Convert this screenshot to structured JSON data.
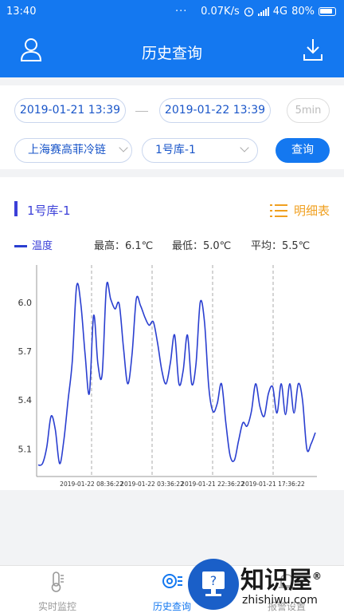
{
  "status_bar": {
    "time": "13:40",
    "dots": "···",
    "net_speed": "0.07K/s",
    "network": "4G",
    "battery": "80%"
  },
  "header": {
    "title": "历史查询"
  },
  "filters": {
    "start_datetime": "2019-01-21 13:39",
    "end_datetime": "2019-01-22 13:39",
    "interval": "5min",
    "company": "上海赛高菲冷链",
    "store": "1号库-1",
    "query_label": "查询"
  },
  "chart_panel": {
    "store_name": "1号库-1",
    "detail_label": "明细表",
    "legend_label": "温度",
    "max_label": "最高：6.1℃",
    "min_label": "最低：5.0℃",
    "avg_label": "平均：5.5℃"
  },
  "chart_data": {
    "type": "line",
    "title": "",
    "xlabel": "",
    "ylabel": "",
    "ylim": [
      4.93,
      6.23
    ],
    "yticks": [
      5.1,
      5.4,
      5.7,
      6.0
    ],
    "ytick_labels": [
      "5.1",
      "5.4",
      "5.7",
      "6.0"
    ],
    "xtick_labels": [
      "2019-01-22 08:36:22",
      "2019-01-22 03:36:22",
      "2019-01-21 22:36:22",
      "2019-01-21 17:36:22"
    ],
    "x_direction": "reversed (newest on the left)",
    "vertical_dashed_lines_at_ticks": true,
    "series": [
      {
        "name": "温度",
        "color": "#2a3fd0",
        "values": [
          5.0,
          5.01,
          5.11,
          5.3,
          5.22,
          5.01,
          5.15,
          5.4,
          5.64,
          6.1,
          5.99,
          5.68,
          5.44,
          5.92,
          5.62,
          5.56,
          6.1,
          6.02,
          5.96,
          5.99,
          5.72,
          5.5,
          5.68,
          6.02,
          5.98,
          5.91,
          5.86,
          5.88,
          5.75,
          5.58,
          5.5,
          5.63,
          5.8,
          5.5,
          5.58,
          5.8,
          5.5,
          5.62,
          6.0,
          5.88,
          5.48,
          5.33,
          5.38,
          5.5,
          5.26,
          5.06,
          5.03,
          5.15,
          5.26,
          5.24,
          5.33,
          5.5,
          5.36,
          5.3,
          5.44,
          5.48,
          5.32,
          5.5,
          5.31,
          5.5,
          5.32,
          5.5,
          5.4,
          5.1,
          5.13,
          5.2
        ]
      }
    ]
  },
  "nav": {
    "tabs": [
      {
        "label": "实时监控"
      },
      {
        "label": "历史查询"
      },
      {
        "label": "报警设置"
      }
    ]
  },
  "watermark": {
    "title": "知识屋",
    "sub": "zhishiwu.com",
    "mark": "®",
    "badge": "?"
  },
  "colors": {
    "primary": "#1478f0",
    "series": "#2a3fd0",
    "accent": "#f0a020"
  }
}
